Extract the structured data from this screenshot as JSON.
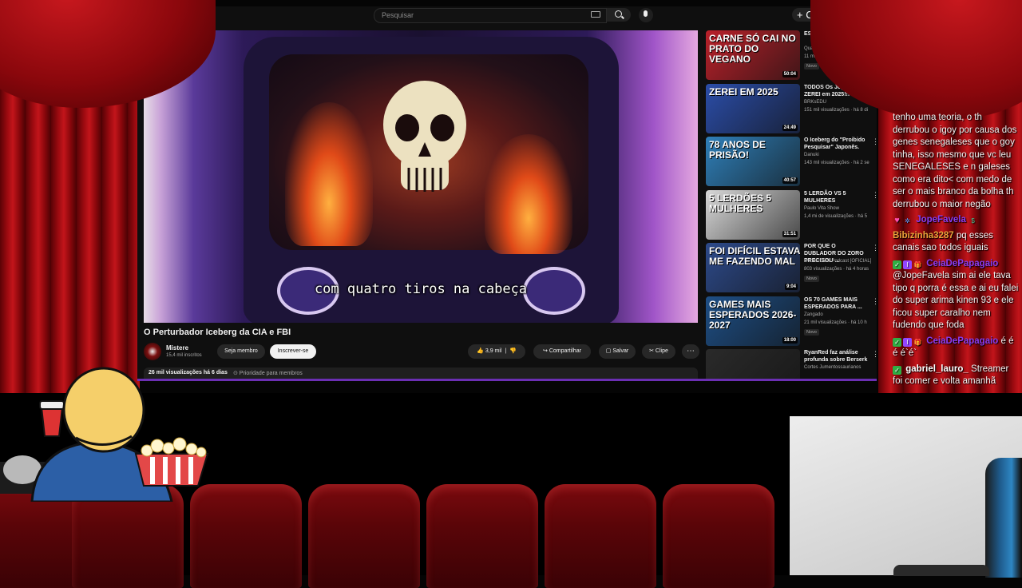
{
  "youtube": {
    "search": {
      "placeholder": "Pesquisar"
    },
    "create_label": "+ C",
    "video": {
      "subtitle": "com quatro tiros na cabeça",
      "title": "O Perturbador Iceberg da CIA e FBI"
    },
    "channel": {
      "name": "Mistere",
      "subscribers": "15,4 mil inscritos",
      "member_label": "Seja membro",
      "subscribe_label": "Inscrever-se"
    },
    "actions": {
      "likes": "3,9 mil",
      "share": "Compartilhar",
      "save": "Salvar",
      "clip": "Clipe",
      "more": "⋯"
    },
    "description": {
      "stats": "26 mil visualizações  há 6 dias",
      "priority": "⊙ Prioridade para membros"
    },
    "recommendations": [
      {
        "title": "ESSA É A ENTRE MEL",
        "channel": "Quadrinhos na S",
        "meta": "11 mil visualizações",
        "badge": "Novo",
        "duration": "50:04",
        "thumb_text": "CARNE SÓ CAI NO PRATO DO VEGANO",
        "color": "#b9212a"
      },
      {
        "title": "TODOS Os Jogos Que ZEREI em 2025!!!",
        "channel": "BRKsEDU",
        "meta": "151 mil visualizações · há 8 di",
        "badge": "",
        "duration": "24:49",
        "thumb_text": "ZEREI EM 2025",
        "color": "#2b4da8"
      },
      {
        "title": "O Iceberg do \"Proibido Pesquisar\" Japonês.",
        "channel": "Danuki",
        "meta": "143 mil visualizações · há 2 se",
        "badge": "",
        "duration": "40:57",
        "thumb_text": "78 ANOS DE PRISÃO!",
        "color": "#2f7fb8"
      },
      {
        "title": "5 LERDÃO VS 5 MULHERES",
        "channel": "Paulo Vita Show",
        "meta": "1,4 mi de visualizações · há 5",
        "badge": "",
        "duration": "31:51",
        "thumb_text": "5 LERDÕES  5 MULHERES",
        "color": "#d8d8d8"
      },
      {
        "title": "POR QUE O DUBLADOR DO ZORO PRECISOU ...",
        "channel": "Cortes DON Podcast [OFICIAL]",
        "meta": "803 visualizações · há 4 horas",
        "badge": "Novo",
        "duration": "9:04",
        "thumb_text": "FOI DIFÍCIL ESTAVA ME FAZENDO MAL",
        "color": "#2d4a8a"
      },
      {
        "title": "OS 70 GAMES MAIS ESPERADOS PARA ...",
        "channel": "Zangado",
        "meta": "21 mil visualizações · há 10 h",
        "badge": "Novo",
        "duration": "18:00",
        "thumb_text": "GAMES MAIS ESPERADOS 2026-2027",
        "color": "#1e4f86"
      },
      {
        "title": "RyanRed faz análise profunda sobre Berserk",
        "channel": "Cortes Jumentossaurianos",
        "meta": "",
        "badge": "",
        "duration": "",
        "thumb_text": "",
        "color": "#2a2a2a"
      }
    ]
  },
  "chat": {
    "messages": [
      {
        "user": "",
        "text": "tenho uma teoria, o th derrubou o igoy por causa dos genes senegaleses que o goy tinha, isso mesmo que vc leu SENEGALESES e n galeses como era dito< com medo de ser o mais branco da bolha th derrubou o maior negão"
      },
      {
        "user": "JopeFavela",
        "text": ""
      },
      {
        "user": "Bibizinha3287",
        "text": "pq esses canais sao todos iguais"
      },
      {
        "user": "CeiaDePapagaio",
        "text": "@JopeFavela sim ai ele tava tipo q porra é essa e ai eu falei do super arima kinen 93 e ele ficou super caralho nem fudendo que foda"
      },
      {
        "user": "CeiaDePapagaio",
        "text": "é é é é`é`"
      },
      {
        "user": "gabriel_lauro_",
        "text": "Streamer foi comer e volta amanhã"
      }
    ]
  }
}
